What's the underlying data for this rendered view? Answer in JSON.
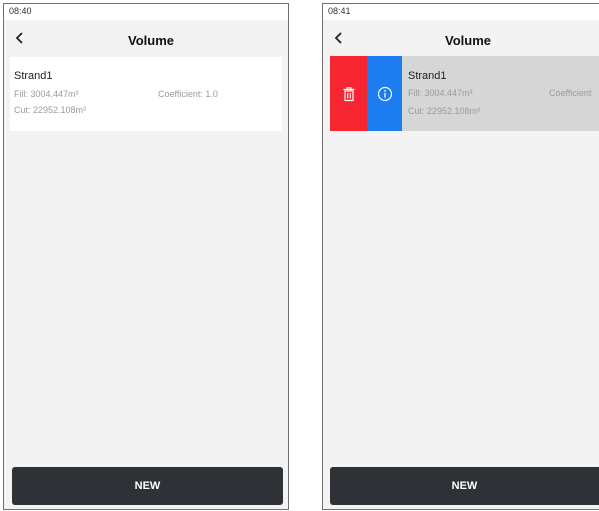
{
  "screens": [
    {
      "time": "08:40",
      "title": "Volume",
      "item": {
        "name": "Strand1",
        "fill": "Fill: 3004.447m³",
        "coefficient": "Coefficient: 1.0",
        "cut": "Cut: 22952.108m³"
      },
      "new_label": "NEW"
    },
    {
      "time": "08:41",
      "title": "Volume",
      "item": {
        "name": "Strand1",
        "fill": "Fill: 3004.447m³",
        "coefficient": "Coefficient",
        "cut": "Cut: 22952.108m³"
      },
      "actions": {
        "delete_icon": "trash-icon",
        "info_icon": "info-icon"
      },
      "new_label": "NEW"
    }
  ],
  "colors": {
    "delete": "#f5262f",
    "info": "#1e7cf1",
    "new_button": "#2e3237"
  }
}
